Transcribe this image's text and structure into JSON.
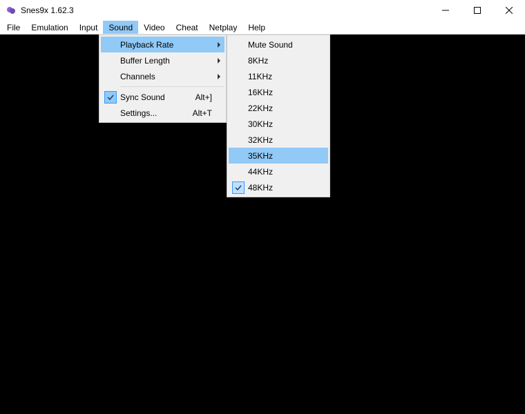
{
  "window": {
    "title": "Snes9x 1.62.3"
  },
  "menubar": {
    "items": [
      {
        "label": "File"
      },
      {
        "label": "Emulation"
      },
      {
        "label": "Input"
      },
      {
        "label": "Sound",
        "selected": true
      },
      {
        "label": "Video"
      },
      {
        "label": "Cheat"
      },
      {
        "label": "Netplay"
      },
      {
        "label": "Help"
      }
    ]
  },
  "sound_menu": {
    "playback_rate": "Playback Rate",
    "buffer_length": "Buffer Length",
    "channels": "Channels",
    "sync_sound": "Sync Sound",
    "sync_sound_shortcut": "Alt+]",
    "settings": "Settings...",
    "settings_shortcut": "Alt+T"
  },
  "playback_menu": {
    "mute": "Mute Sound",
    "rates": [
      "8KHz",
      "11KHz",
      "16KHz",
      "22KHz",
      "30KHz",
      "32KHz",
      "35KHz",
      "44KHz",
      "48KHz"
    ],
    "highlighted": "35KHz",
    "checked": "48KHz"
  }
}
